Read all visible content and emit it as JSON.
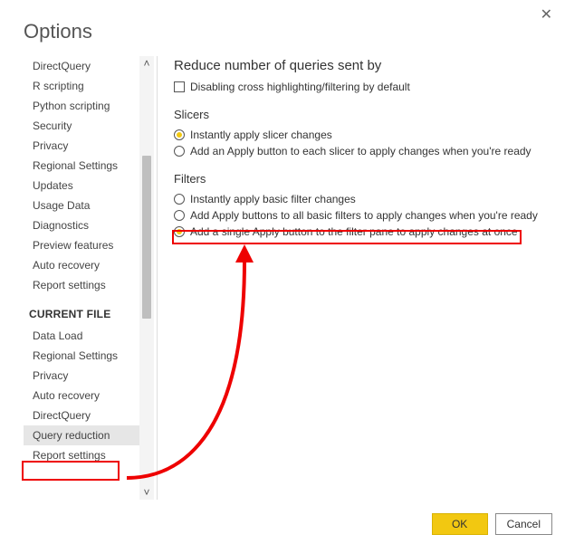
{
  "window": {
    "title": "Options",
    "close_glyph": "✕"
  },
  "sidebar": {
    "items": [
      "DirectQuery",
      "R scripting",
      "Python scripting",
      "Security",
      "Privacy",
      "Regional Settings",
      "Updates",
      "Usage Data",
      "Diagnostics",
      "Preview features",
      "Auto recovery",
      "Report settings"
    ],
    "section2": "CURRENT FILE",
    "items2": [
      "Data Load",
      "Regional Settings",
      "Privacy",
      "Auto recovery",
      "DirectQuery",
      "Query reduction",
      "Report settings"
    ],
    "selected2_index": 5
  },
  "content": {
    "title": "Reduce number of queries sent by",
    "cb1": "Disabling cross highlighting/filtering by default",
    "slicers_title": "Slicers",
    "slicer_r1": "Instantly apply slicer changes",
    "slicer_r2": "Add an Apply button to each slicer to apply changes when you're ready",
    "filters_title": "Filters",
    "filter_r1": "Instantly apply basic filter changes",
    "filter_r2": "Add Apply buttons to all basic filters to apply changes when you're ready",
    "filter_r3": "Add a single Apply button to the filter pane to apply changes at once"
  },
  "footer": {
    "ok": "OK",
    "cancel": "Cancel"
  },
  "scroll": {
    "up_glyph": "˄",
    "down_glyph": "˅"
  }
}
